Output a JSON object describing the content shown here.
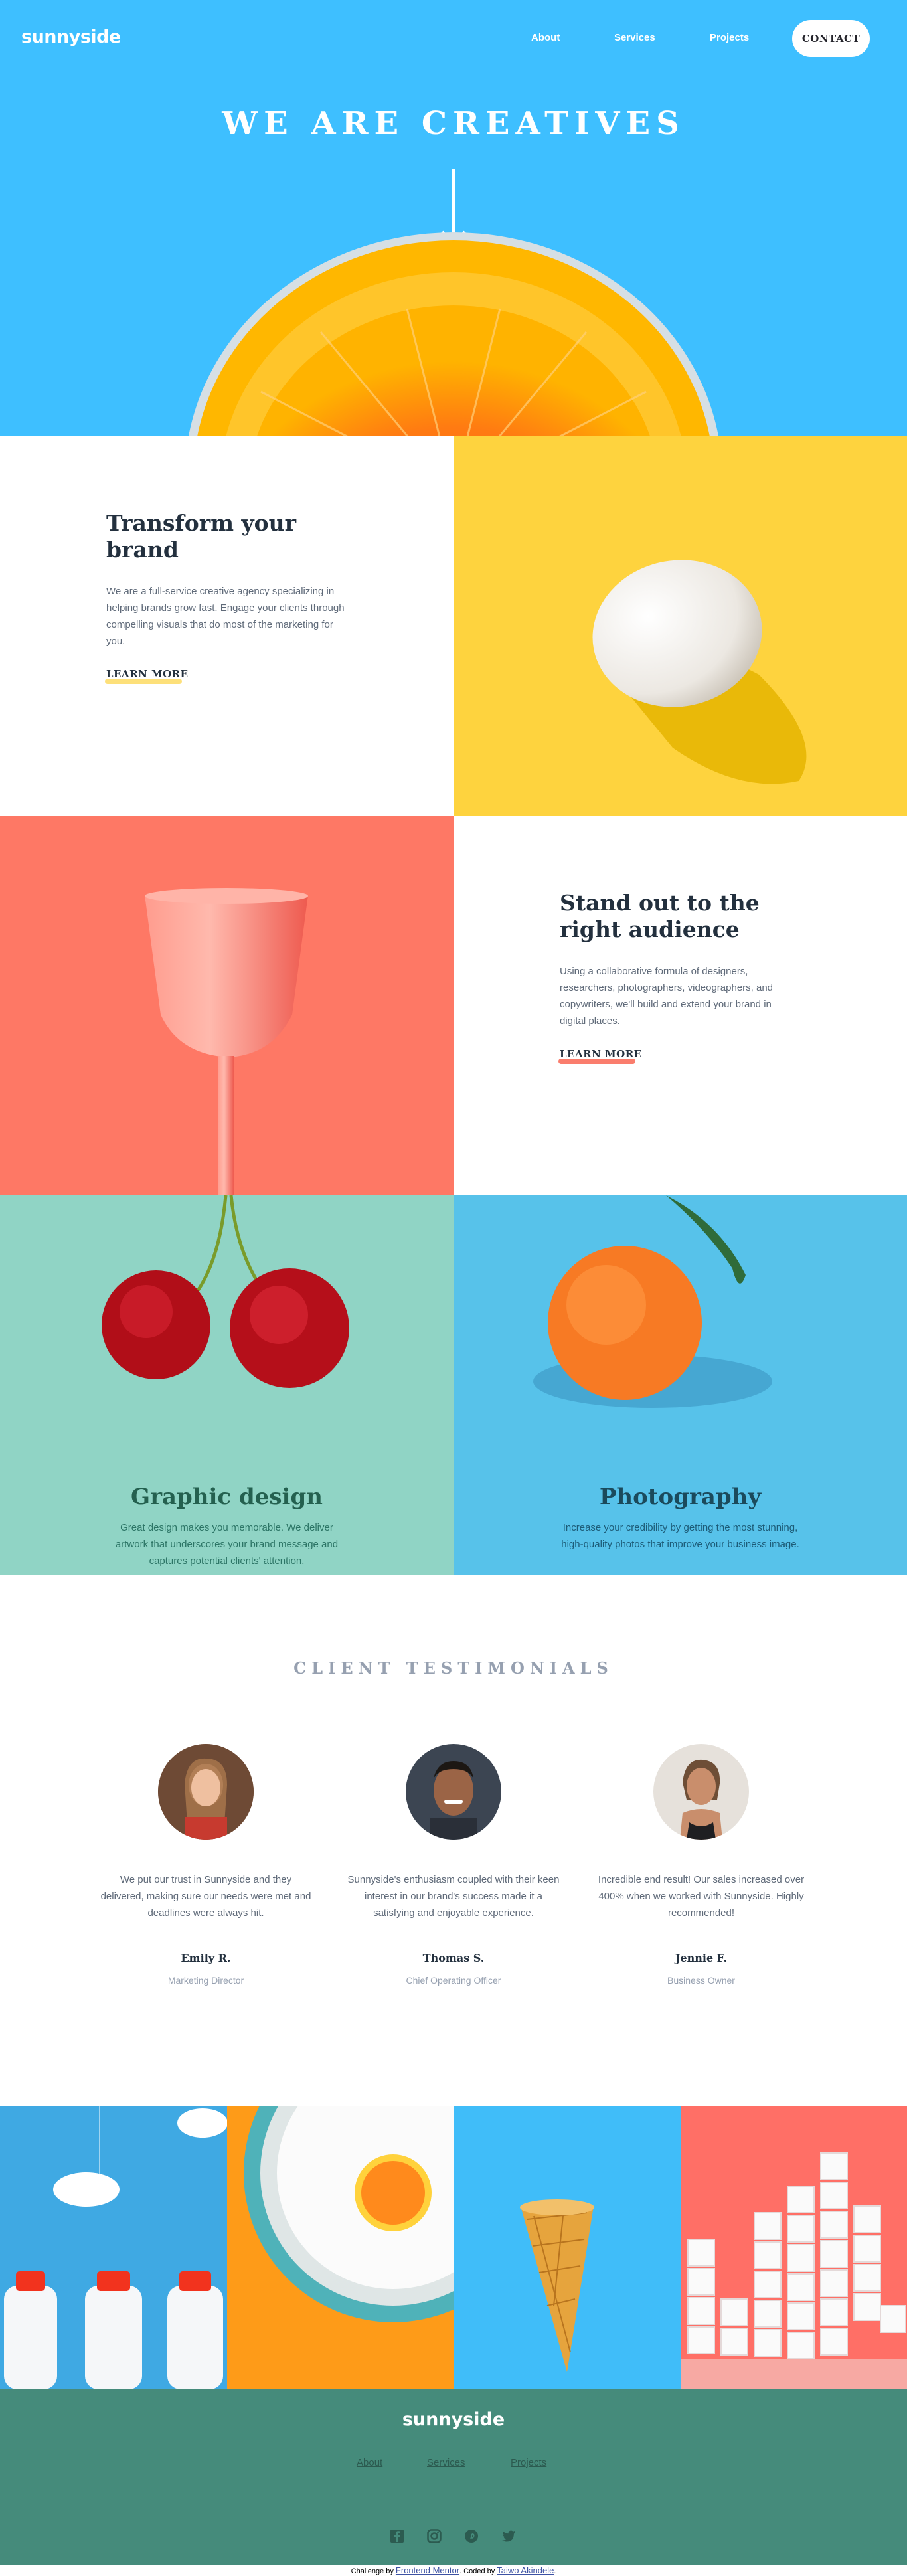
{
  "header": {
    "logo": "sunnyside",
    "nav": {
      "about": "About",
      "services": "Services",
      "projects": "Projects",
      "contact": "CONTACT"
    }
  },
  "hero": {
    "title": "WE ARE CREATIVES"
  },
  "transform": {
    "title": "Transform your brand",
    "body": "We are a full-service creative agency specializing in helping brands grow fast. Engage your clients through compelling visuals that do most of the marketing for you.",
    "link": "LEARN MORE"
  },
  "standout": {
    "title": "Stand out to the right audience",
    "body": "Using a collaborative formula of designers, researchers, photographers, videographers, and copywriters, we'll build and extend your brand in digital places.",
    "link": "LEARN MORE"
  },
  "graphic": {
    "title": "Graphic design",
    "body": "Great design makes you memorable. We deliver artwork that underscores your brand message and captures potential clients' attention."
  },
  "photo": {
    "title": "Photography",
    "body": "Increase your credibility by getting the most stunning, high-quality photos that improve your business image."
  },
  "testimonials": {
    "heading": "CLIENT TESTIMONIALS",
    "items": [
      {
        "quote": "We put our trust in Sunnyside and they delivered, making sure our needs were met and deadlines were always hit.",
        "name": "Emily R.",
        "role": "Marketing Director"
      },
      {
        "quote": "Sunnyside's enthusiasm coupled with their keen interest in our brand's success made it a satisfying and enjoyable experience.",
        "name": "Thomas S.",
        "role": "Chief Operating Officer"
      },
      {
        "quote": "Incredible end result! Our sales increased over 400% when we worked with Sunnyside. Highly recommended!",
        "name": "Jennie F.",
        "role": "Business Owner"
      }
    ]
  },
  "footer": {
    "logo": "sunnyside",
    "links": {
      "about": "About",
      "services": "Services",
      "projects": "Projects"
    },
    "social": [
      "facebook-icon",
      "instagram-icon",
      "pinterest-icon",
      "twitter-icon"
    ]
  },
  "attribution": {
    "prefix": "Challenge by",
    "link1": "Frontend Mentor",
    "middle": ". Coded by",
    "link2": "Taiwo Akindele",
    "suffix": "."
  },
  "colors": {
    "hero_bg": "#3ebfff",
    "yellow": "#fed33e",
    "red_accent": "#fe7865",
    "graphic_bg": "#90d4c5",
    "graphic_text": "#24604f",
    "photo_bg": "#57c2ea",
    "photo_text": "#1b4a5c",
    "footer_bg": "#458b7b"
  }
}
